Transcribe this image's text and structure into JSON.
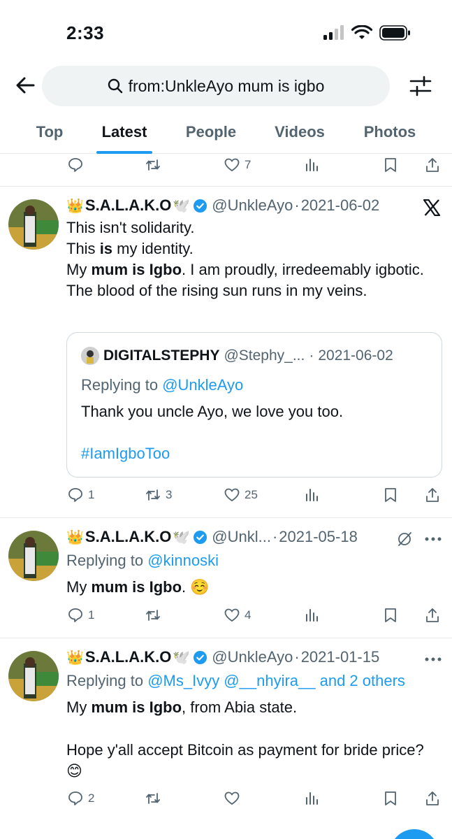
{
  "status_bar": {
    "time": "2:33"
  },
  "search": {
    "query": "from:UnkleAyo mum is igbo"
  },
  "tabs": [
    "Top",
    "Latest",
    "People",
    "Videos",
    "Photos"
  ],
  "active_tab": "Latest",
  "prev_actions": {
    "likes": "7"
  },
  "tweets": [
    {
      "crown": "👑",
      "name": "S.A.L.A.K.O",
      "dove": "🕊️",
      "handle": "@UnkleAyo",
      "date": "2021-06-02",
      "corner_icon": "x-logo-icon",
      "line1": "This isn't solidarity.",
      "line2_pre": "This ",
      "line2_bold": "is",
      "line2_post": " my identity.",
      "line3_pre": "My ",
      "line3_bold": "mum is Igbo",
      "line3_post": ". I am proudly, irredeemably igbotic.",
      "line4": "The blood of the rising sun runs in my veins.",
      "quote": {
        "name": "DIGITALSTEPHY",
        "handle": "@Stephy_...",
        "date": "2021-06-02",
        "replying_label": "Replying to ",
        "replying_to": "@UnkleAyo",
        "text": "Thank you uncle Ayo, we love you too.",
        "hashtag": "#IamIgboToo"
      },
      "replies": "1",
      "retweets": "3",
      "likes": "25"
    },
    {
      "crown": "👑",
      "name": "S.A.L.A.K.O",
      "dove": "🕊️",
      "handle": "@Unkl...",
      "date": "2021-05-18",
      "replying_label": "Replying to ",
      "replying_to": "@kinnoski",
      "text_pre": "My ",
      "text_bold": "mum is Igbo",
      "text_post": ". ☺️",
      "replies": "1",
      "retweets": "",
      "likes": "4"
    },
    {
      "crown": "👑",
      "name": "S.A.L.A.K.O",
      "dove": "🕊️",
      "handle": "@UnkleAyo",
      "date": "2021-01-15",
      "replying_label": "Replying to ",
      "replying_to": "@Ms_Ivyy @__nhyira__ and 2 others",
      "text_pre": "My ",
      "text_bold": "mum is Igbo",
      "text_post": ", from Abia state.",
      "text2": "Hope y'all accept Bitcoin as payment for bride price? 😊",
      "replies": "2",
      "retweets": "",
      "likes": ""
    }
  ],
  "colors": {
    "accent": "#1d9bf0",
    "secondary_text": "#536471",
    "verified": "#1d9bf0"
  }
}
